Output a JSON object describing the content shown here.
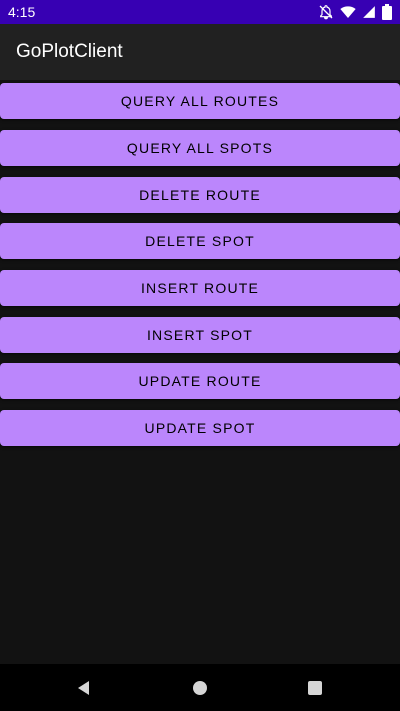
{
  "status_bar": {
    "time": "4:15",
    "icons": [
      "notifications-off-icon",
      "wifi-icon",
      "cellular-signal-icon",
      "battery-icon"
    ],
    "background": "#3700B3"
  },
  "app_bar": {
    "title": "GoPlotClient",
    "background": "#212121"
  },
  "buttons": [
    {
      "label": "QUERY ALL ROUTES"
    },
    {
      "label": "QUERY ALL SPOTS"
    },
    {
      "label": "DELETE ROUTE"
    },
    {
      "label": "DELETE SPOT"
    },
    {
      "label": "INSERT ROUTE"
    },
    {
      "label": "INSERT SPOT"
    },
    {
      "label": "UPDATE ROUTE"
    },
    {
      "label": "UPDATE SPOT"
    }
  ],
  "button_color": "#BB86FC",
  "background_color": "#121212",
  "nav_bar": {
    "items": [
      "back-icon",
      "home-icon",
      "recents-icon"
    ]
  }
}
